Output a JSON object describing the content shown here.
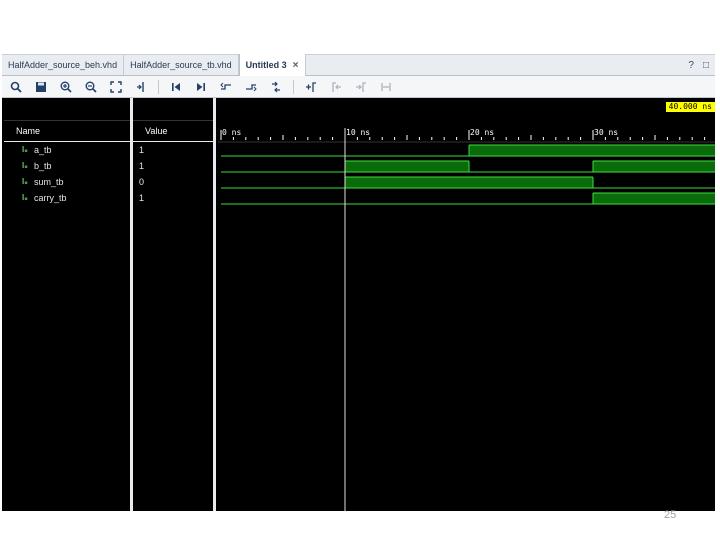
{
  "tabs": [
    {
      "label": "HalfAdder_source_beh.vhd",
      "active": false
    },
    {
      "label": "HalfAdder_source_tb.vhd",
      "active": false
    },
    {
      "label": "Untitled 3",
      "active": true,
      "close": "×"
    }
  ],
  "tab_actions": {
    "help": "?",
    "restore": "□"
  },
  "toolbar": {
    "icons": [
      "search-icon",
      "save-icon",
      "zoom-in-icon",
      "zoom-out-icon",
      "zoom-fit-icon",
      "goto-cursor-icon",
      "goto-start-icon",
      "goto-end-icon",
      "prev-transition-icon",
      "next-transition-icon",
      "add-marker-icon",
      "prev-marker-icon",
      "next-marker-icon",
      "swap-cursors-icon"
    ]
  },
  "wave_window": {
    "name_header": "Name",
    "value_header": "Value",
    "cursor_time": "40.000 ns",
    "signal_icon_text": "l₆",
    "signals": [
      {
        "name": "a_tb",
        "value": "1"
      },
      {
        "name": "b_tb",
        "value": "1"
      },
      {
        "name": "sum_tb",
        "value": "0"
      },
      {
        "name": "carry_tb",
        "value": "1"
      }
    ],
    "time_axis": {
      "range_ns": [
        0,
        40
      ],
      "tick_labels": [
        {
          "text": "0 ns",
          "time": 0
        },
        {
          "text": "10 ns",
          "time": 10
        },
        {
          "text": "20 ns",
          "time": 20
        },
        {
          "text": "30 ns",
          "time": 30
        }
      ],
      "cursor_ns": 10
    },
    "waveforms": [
      {
        "signal": "a_tb",
        "transitions": [
          [
            0,
            0
          ],
          [
            20,
            1
          ]
        ]
      },
      {
        "signal": "b_tb",
        "transitions": [
          [
            0,
            0
          ],
          [
            10,
            1
          ],
          [
            20,
            0
          ],
          [
            30,
            1
          ]
        ]
      },
      {
        "signal": "sum_tb",
        "transitions": [
          [
            0,
            0
          ],
          [
            10,
            1
          ],
          [
            30,
            0
          ]
        ]
      },
      {
        "signal": "carry_tb",
        "transitions": [
          [
            0,
            0
          ],
          [
            30,
            1
          ]
        ]
      }
    ],
    "colors": {
      "high_fill": "#0a6b0a",
      "line": "#3fdc3f",
      "cursor": "#e0e0e0",
      "marker_bg": "#ffff00"
    }
  },
  "page_number": "25"
}
